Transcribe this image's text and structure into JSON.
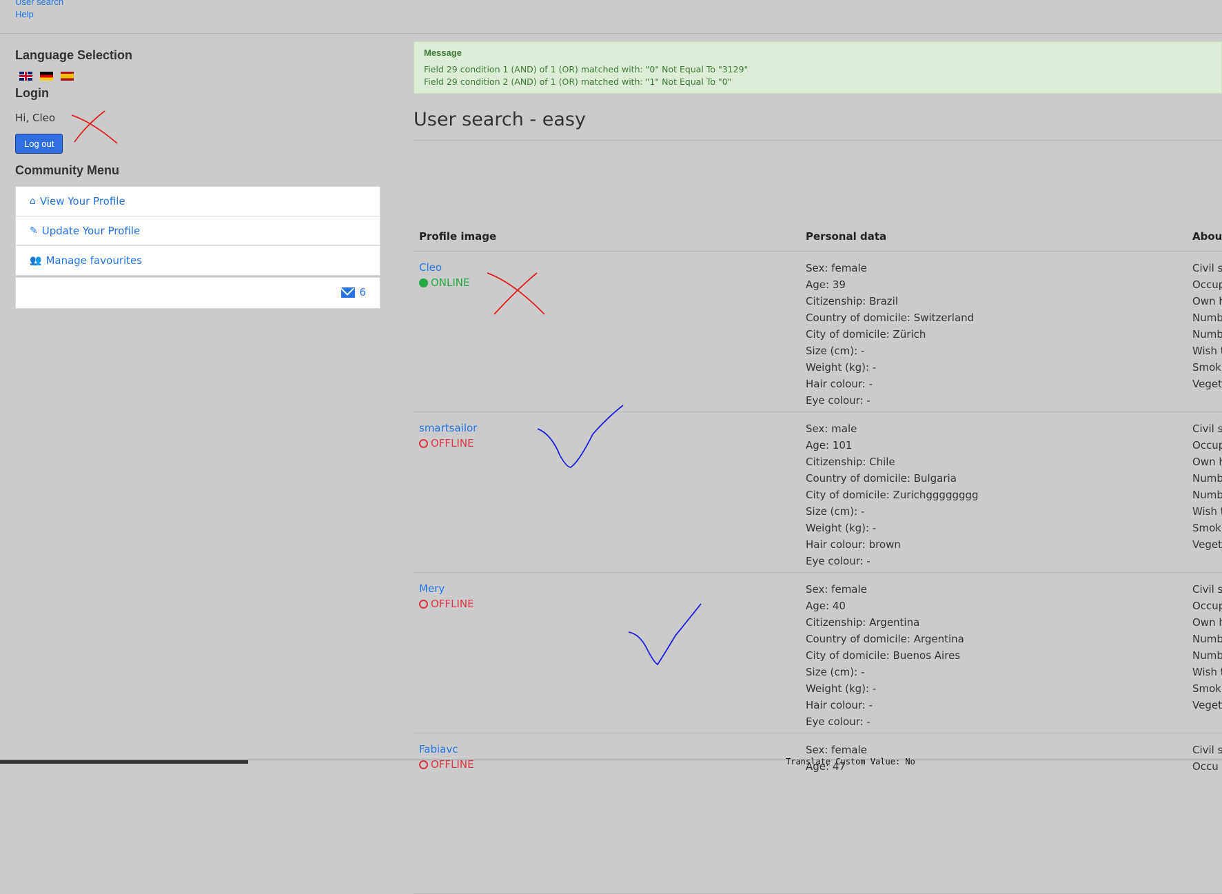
{
  "top_links": [
    "User search",
    "Help"
  ],
  "sidebar": {
    "language_title": "Language Selection",
    "flags": [
      "gb-flag",
      "de-flag",
      "es-flag"
    ],
    "login_title": "Login",
    "greeting": "Hi, Cleo",
    "logout_label": "Log out",
    "community_title": "Community Menu",
    "menu": [
      {
        "label": "View Your Profile",
        "icon": "home-icon"
      },
      {
        "label": "Update Your Profile",
        "icon": "edit-icon"
      },
      {
        "label": "Manage favourites",
        "icon": "users-icon"
      }
    ],
    "message_count": "6"
  },
  "alert": {
    "title": "Message",
    "lines": [
      "Field 29 condition 1 (AND) of 1 (OR) matched with: \"0\" Not Equal To \"3129\"",
      "Field 29 condition 2 (AND) of 1 (OR) matched with: \"1\" Not Equal To \"0\""
    ]
  },
  "page_title": "User search - easy",
  "table": {
    "headers": [
      "Profile image",
      "Personal data",
      "Abou"
    ],
    "rows": [
      {
        "username": "Cleo",
        "status": "ONLINE",
        "personal": [
          "Sex: female",
          "Age: 39",
          "Citizenship: Brazil",
          "Country of domicile: Switzerland",
          "City of domicile: Zürich",
          "Size (cm): -",
          "Weight (kg): -",
          "Hair colour: -",
          "Eye colour: -"
        ],
        "about": [
          "Civil s",
          "Occup",
          "Own h",
          "Numb",
          "Numb",
          "Wish t",
          "Smok",
          "Veget"
        ]
      },
      {
        "username": "smartsailor",
        "status": "OFFLINE",
        "personal": [
          "Sex: male",
          "Age: 101",
          "Citizenship: Chile",
          "Country of domicile: Bulgaria",
          "City of domicile: Zurichgggggggg",
          "Size (cm): -",
          "Weight (kg): -",
          "Hair colour: brown",
          "Eye colour: -"
        ],
        "about": [
          "Civil s",
          "Occup",
          "Own h",
          "Numb",
          "Numb",
          "Wish t",
          "Smok",
          "Veget"
        ]
      },
      {
        "username": "Mery",
        "status": "OFFLINE",
        "personal": [
          "Sex: female",
          "Age: 40",
          "Citizenship: Argentina",
          "Country of domicile: Argentina",
          "City of domicile: Buenos Aires",
          "Size (cm): -",
          "Weight (kg): -",
          "Hair colour: -",
          "Eye colour: -"
        ],
        "about": [
          "Civil s",
          "Occup",
          "Own h",
          "Numb",
          "Numb",
          "Wish t",
          "Smok",
          "Veget"
        ]
      },
      {
        "username": "Fabiavc",
        "status": "OFFLINE",
        "personal": [
          "Sex: female",
          "Age: 47"
        ],
        "about": [
          "Civil s",
          "Occu"
        ]
      }
    ]
  },
  "bottom_text": "Translate Custom Value: No",
  "colors": {
    "link": "#2474e6",
    "online": "#28a745",
    "offline": "#dc3545",
    "alert_bg": "#dcecd7",
    "background": "#cbcbcb"
  }
}
